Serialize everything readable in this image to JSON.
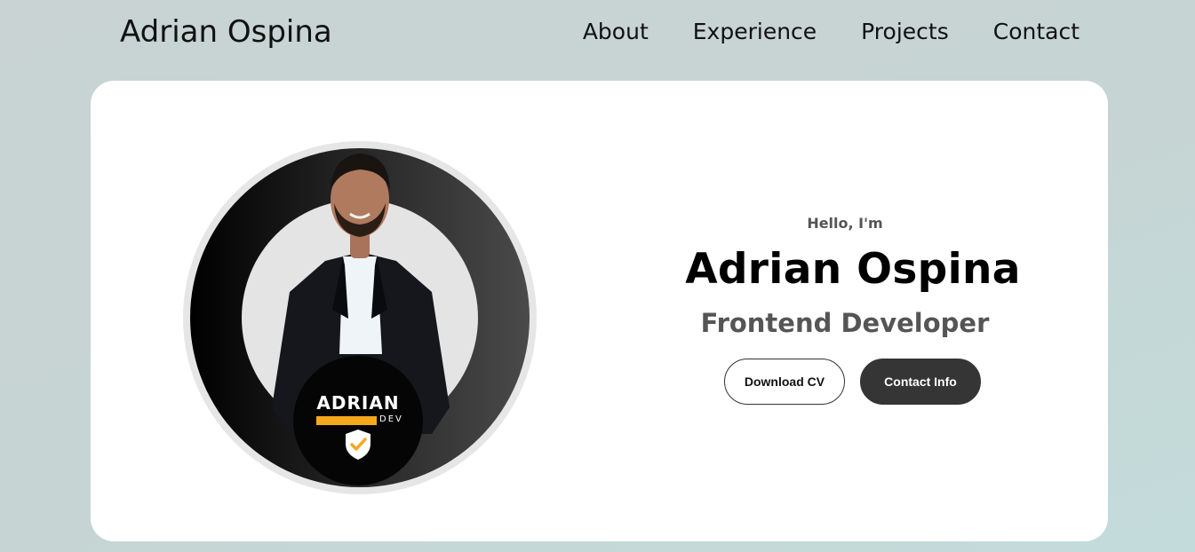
{
  "header": {
    "logo": "Adrian Ospina",
    "nav": [
      "About",
      "Experience",
      "Projects",
      "Contact"
    ]
  },
  "hero": {
    "greeting": "Hello, I'm",
    "name": "Adrian Ospina",
    "role": "Frontend Developer",
    "buttons": {
      "download_cv": "Download CV",
      "contact_info": "Contact Info"
    },
    "badge": {
      "name": "ADRIAN",
      "sub": "DEV",
      "icon": "shield-check-icon"
    },
    "profile_image_alt": "profile-picture"
  },
  "colors": {
    "accent": "#f4a81d",
    "dark_button": "#353535"
  }
}
